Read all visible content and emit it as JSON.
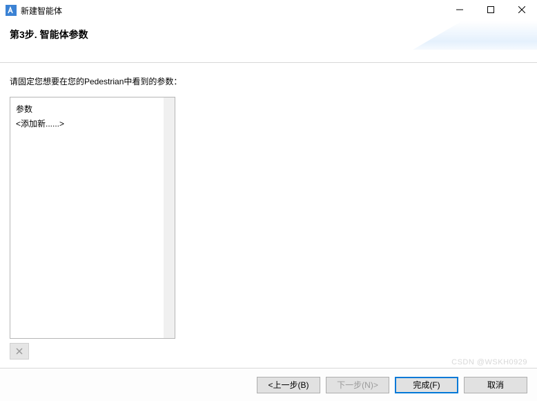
{
  "window": {
    "title": "新建智能体"
  },
  "banner": {
    "title": "第3步. 智能体参数"
  },
  "content": {
    "instruction": "请固定您想要在您的Pedestrian中看到的参数：",
    "param_header": "参数",
    "param_placeholder": "<添加新......>"
  },
  "footer": {
    "back": "<上一步(B)",
    "next": "下一步(N)>",
    "finish": "完成(F)",
    "cancel": "取消"
  },
  "watermark": "CSDN @WSKH0929"
}
